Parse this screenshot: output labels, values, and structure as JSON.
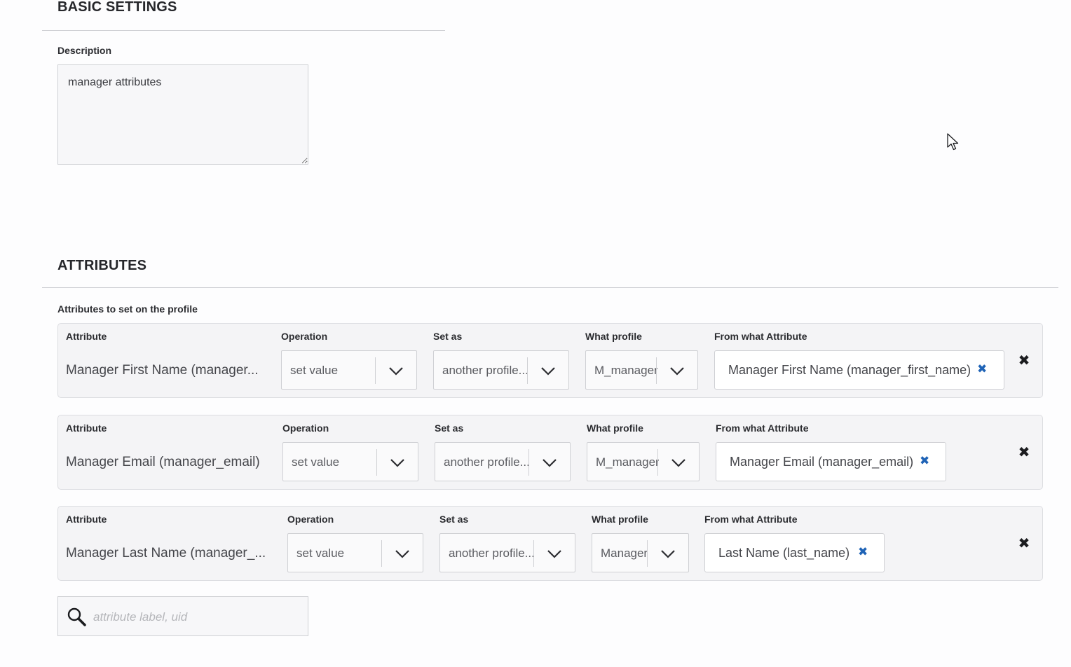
{
  "basic_settings": {
    "title": "BASIC SETTINGS",
    "description_label": "Description",
    "description_value": "manager attributes"
  },
  "attributes": {
    "title": "ATTRIBUTES",
    "subtitle": "Attributes to set on the profile",
    "rows": [
      {
        "attribute_label": "Attribute",
        "attribute_value": "Manager First Name (manager...",
        "operation_label": "Operation",
        "operation_value": "set value",
        "set_as_label": "Set as",
        "set_as_value": "another profile...",
        "what_profile_label": "What profile",
        "what_profile_value": "M_manager",
        "from_attribute_label": "From what Attribute",
        "from_attribute_value": "Manager First Name (manager_first_name)"
      },
      {
        "attribute_label": "Attribute",
        "attribute_value": "Manager Email (manager_email)",
        "operation_label": "Operation",
        "operation_value": "set value",
        "set_as_label": "Set as",
        "set_as_value": "another profile...",
        "what_profile_label": "What profile",
        "what_profile_value": "M_manager",
        "from_attribute_label": "From what Attribute",
        "from_attribute_value": "Manager Email (manager_email)"
      },
      {
        "attribute_label": "Attribute",
        "attribute_value": "Manager Last Name (manager_...",
        "operation_label": "Operation",
        "operation_value": "set value",
        "set_as_label": "Set as",
        "set_as_value": "another profile...",
        "what_profile_label": "What profile",
        "what_profile_value": "Manager",
        "from_attribute_label": "From what Attribute",
        "from_attribute_value": "Last Name (last_name)"
      }
    ],
    "search": {
      "placeholder": "attribute label, uid"
    }
  },
  "icons": {
    "remove_tag": "close-icon",
    "remove_row": "close-icon",
    "dropdown": "chevron-down-icon",
    "search": "search-icon"
  },
  "colors": {
    "accent_blue": "#1f63b6",
    "card_bg": "#f4f4f6",
    "border": "#cfd0d4"
  }
}
